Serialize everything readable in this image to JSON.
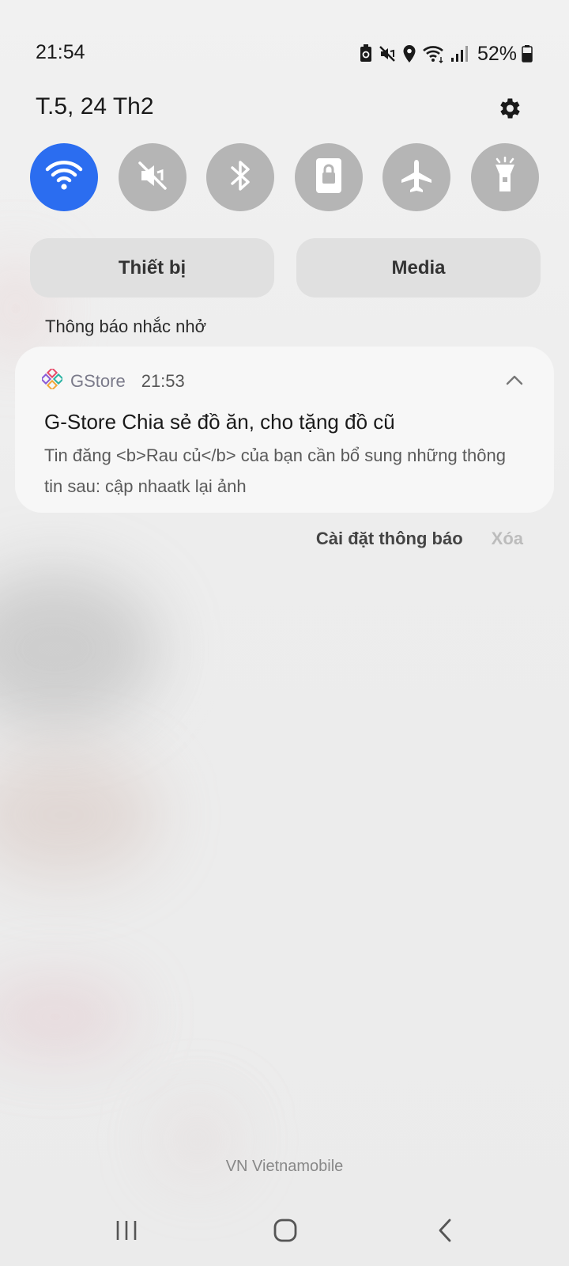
{
  "status_bar": {
    "time": "21:54",
    "battery_percent": "52%",
    "icons": [
      "battery-saver-icon",
      "mute-icon",
      "location-icon",
      "wifi-icon",
      "signal-icon",
      "battery-icon"
    ]
  },
  "header": {
    "date": "T.5, 24 Th2",
    "settings_icon": "gear-icon"
  },
  "quick_toggles": [
    {
      "name": "wifi",
      "icon": "wifi-icon",
      "active": true
    },
    {
      "name": "sound",
      "icon": "mute-icon",
      "active": false
    },
    {
      "name": "bluetooth",
      "icon": "bluetooth-icon",
      "active": false
    },
    {
      "name": "rotation-lock",
      "icon": "lock-icon",
      "active": false
    },
    {
      "name": "airplane-mode",
      "icon": "airplane-icon",
      "active": false
    },
    {
      "name": "flashlight",
      "icon": "flashlight-icon",
      "active": false
    }
  ],
  "panels": {
    "devices_label": "Thiết bị",
    "media_label": "Media"
  },
  "notifications": {
    "section_label": "Thông báo nhắc nhở",
    "items": [
      {
        "app_name": "GStore",
        "time": "21:53",
        "title": "G-Store Chia sẻ đồ ăn, cho tặng đồ cũ",
        "body": "Tin đăng <b>Rau củ</b> của bạn cần bổ sung những thông tin sau: cập nhaatk lại ảnh"
      }
    ],
    "settings_label": "Cài đặt thông báo",
    "clear_label": "Xóa"
  },
  "carrier": "VN Vietnamobile",
  "colors": {
    "accent": "#2b6df0",
    "toggle_inactive": "#b5b5b5"
  }
}
